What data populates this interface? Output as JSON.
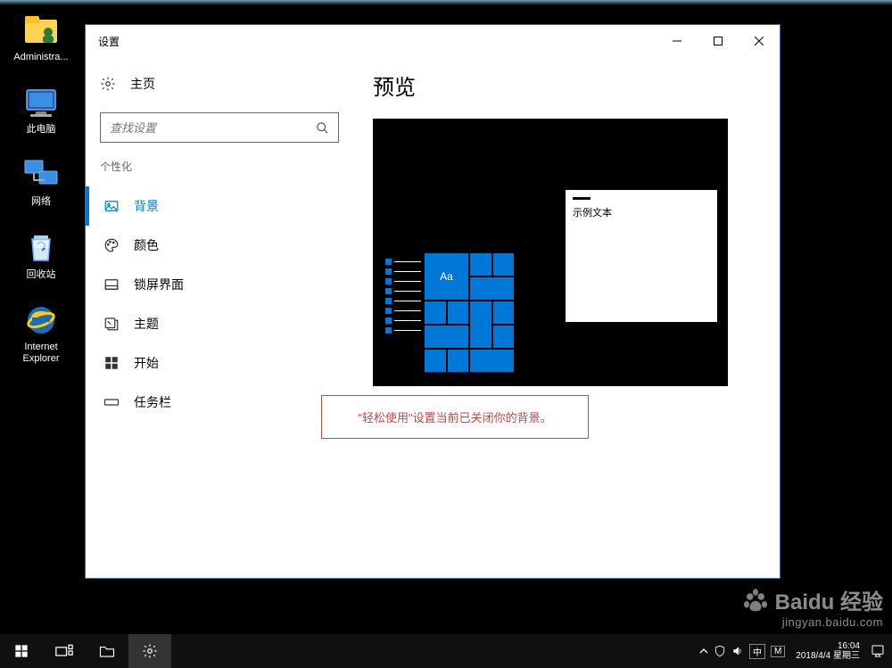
{
  "desktop": {
    "icons": [
      {
        "label": "Administra..."
      },
      {
        "label": "此电脑"
      },
      {
        "label": "网络"
      },
      {
        "label": "回收站"
      },
      {
        "label": "Internet Explorer"
      }
    ]
  },
  "window": {
    "title": "设置",
    "home": "主页",
    "search_placeholder": "查找设置",
    "section": "个性化",
    "nav": [
      {
        "label": "背景",
        "active": true
      },
      {
        "label": "颜色"
      },
      {
        "label": "锁屏界面"
      },
      {
        "label": "主题"
      },
      {
        "label": "开始"
      },
      {
        "label": "任务栏"
      }
    ],
    "content": {
      "heading": "预览",
      "preview_sample_text": "示例文本",
      "preview_tile_text": "Aa",
      "alert": "\"轻松使用\"设置当前已关闭你的背景。"
    }
  },
  "taskbar": {
    "clock_time": "16:04",
    "clock_date": "2018/4/4 星期三",
    "ime": [
      "中",
      "M"
    ]
  },
  "watermark": {
    "main": "Baidu 经验",
    "sub": "jingyan.baidu.com"
  }
}
